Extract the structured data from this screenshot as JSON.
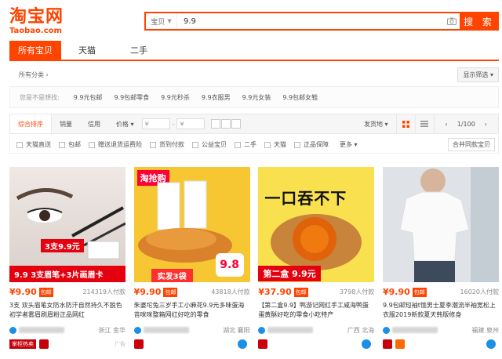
{
  "logo": {
    "cn": "淘宝网",
    "en": "Taobao.com"
  },
  "search": {
    "category": "宝贝",
    "query": "9.9",
    "button": "搜 索"
  },
  "tabs": [
    "所有宝贝",
    "天猫",
    "二手"
  ],
  "breadcrumb": {
    "all": "所有分类",
    "display_filter": "显示筛选"
  },
  "suggest": {
    "label": "您是不是想找:",
    "items": [
      "9.9元包邮",
      "9.9包邮零食",
      "9.9元秒杀",
      "9.9衣服男",
      "9.9元女装",
      "9.9包邮女鞋"
    ]
  },
  "sort": {
    "items": [
      "综合排序",
      "销量",
      "信用",
      "价格"
    ],
    "price_from_ph": "¥",
    "price_to_ph": "¥",
    "ship_from": "发货地",
    "page": "1/100"
  },
  "filters": {
    "items": [
      "天猫直送",
      "包邮",
      "赠送退货运费险",
      "货到付款",
      "公益宝贝",
      "二手",
      "天猫",
      "正品保障"
    ],
    "more": "更多",
    "same": "合并同款宝贝"
  },
  "products": [
    {
      "price": "¥9.90",
      "badge": "包邮",
      "sold": "214319人付款",
      "title": "3支 双头眉笔女防水防汗自然持久不脱色初学者雾眉刷眉粉正品网红",
      "loc": "浙江 金华",
      "tag": "掌柜热卖",
      "ad": "广告",
      "img_text": "3支9.9元",
      "img_text2": "9.9 3支眉笔+3片画眉卡"
    },
    {
      "price": "¥9.90",
      "badge": "包邮",
      "sold": "43818人付款",
      "title": "朱婆坨兔三岁手工小麻花9.9元多味蛋海苔咪咪整箱网红好吃的零食",
      "loc": "湖北 襄阳",
      "img_text": "淘抢购",
      "img_text2": "实发3袋",
      "img_text3": "9.8"
    },
    {
      "price": "¥37.90",
      "badge": "包邮",
      "sold": "3798人付款",
      "title": "【第二盒9.9】鸭游记网红手工咸海鸭蛋蛋黄酥好吃的零食小吃特产",
      "title_hl": "9.9",
      "loc": "广西 北海",
      "img_text": "一口吞不下",
      "img_text2": "第二盒 9.9元"
    },
    {
      "price": "¥9.90",
      "badge": "包邮",
      "sold": "16020人付款",
      "title": "9.9包邮短袖t恤男士夏季潮流半袖宽松上衣服2019新款夏天韩版修身",
      "loc": "福建 泉州"
    }
  ],
  "colors": {
    "accent": "#ff4400",
    "tmall_red": "#c7000b"
  }
}
